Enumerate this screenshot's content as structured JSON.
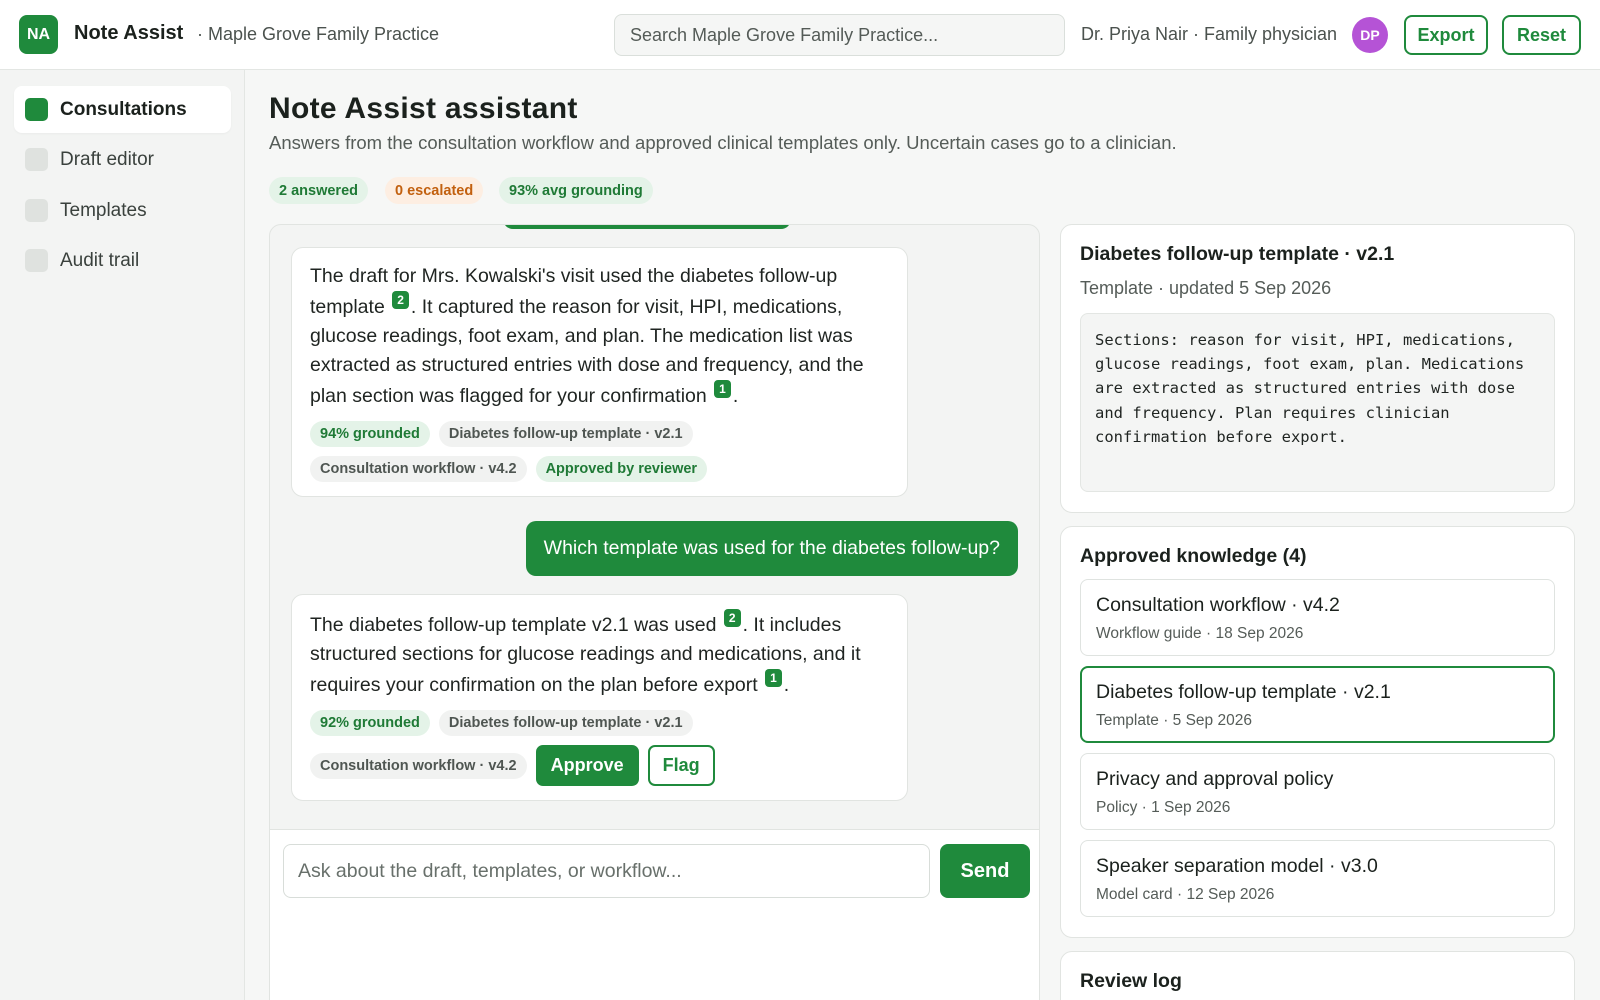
{
  "header": {
    "logo_initials": "NA",
    "app_name": "Note Assist",
    "practice": "· Maple Grove Family Practice",
    "search_placeholder": "Search Maple Grove Family Practice...",
    "user": "Dr. Priya Nair · Family physician",
    "avatar_initials": "DP",
    "export_label": "Export",
    "reset_label": "Reset"
  },
  "sidebar": {
    "items": [
      {
        "label": "Consultations",
        "active": true
      },
      {
        "label": "Draft editor",
        "active": false
      },
      {
        "label": "Templates",
        "active": false
      },
      {
        "label": "Audit trail",
        "active": false
      }
    ]
  },
  "main": {
    "title": "Note Assist assistant",
    "subtitle": "Answers from the consultation workflow and approved clinical templates only. Uncertain cases go to a clinician.",
    "stats": {
      "answered": "2 answered",
      "escalated": "0 escalated",
      "grounding": "93% avg grounding"
    }
  },
  "chat": {
    "messages": [
      {
        "role": "assistant",
        "segments": [
          "The draft for Mrs. Kowalski's visit used the diabetes follow-up template ",
          "2",
          ". It captured the reason for visit, HPI, medications, glucose readings, foot exam, and plan. The medication list was extracted as structured entries with dose and frequency, and the plan section was flagged for your confirmation ",
          "1",
          "."
        ],
        "grounded": "94% grounded",
        "source_1": "Diabetes follow-up template · v2.1",
        "source_2": "Consultation workflow · v4.2",
        "status": "Approved by reviewer"
      },
      {
        "role": "user",
        "text": "Which template was used for the diabetes follow-up?"
      },
      {
        "role": "assistant",
        "segments": [
          "The diabetes follow-up template v2.1 was used ",
          "2",
          ". It includes structured sections for glucose readings and medications, and it requires your confirmation on the plan before export ",
          "1",
          "."
        ],
        "grounded": "92% grounded",
        "source_1": "Diabetes follow-up template · v2.1",
        "source_2": "Consultation workflow · v4.2",
        "approve_label": "Approve",
        "flag_label": "Flag"
      }
    ],
    "composer_placeholder": "Ask about the draft, templates, or workflow...",
    "send_label": "Send"
  },
  "detail": {
    "title": "Diabetes follow-up template · v2.1",
    "meta": "Template · updated 5 Sep 2026",
    "body": "Sections: reason for visit, HPI, medications, glucose readings, foot exam, plan. Medications are extracted as structured entries with dose and frequency. Plan requires clinician confirmation before export."
  },
  "knowledge": {
    "title": "Approved knowledge (4)",
    "items": [
      {
        "name": "Consultation workflow · v4.2",
        "meta": "Workflow guide · 18 Sep 2026",
        "selected": false
      },
      {
        "name": "Diabetes follow-up template · v2.1",
        "meta": "Template · 5 Sep 2026",
        "selected": true
      },
      {
        "name": "Privacy and approval policy",
        "meta": "Policy · 1 Sep 2026",
        "selected": false
      },
      {
        "name": "Speaker separation model · v3.0",
        "meta": "Model card · 12 Sep 2026",
        "selected": false
      }
    ]
  },
  "review_log": {
    "title": "Review log"
  },
  "colors": {
    "accent": "#1f8a3c",
    "avatar": "#b553d6",
    "escalated": "#c2600f"
  }
}
